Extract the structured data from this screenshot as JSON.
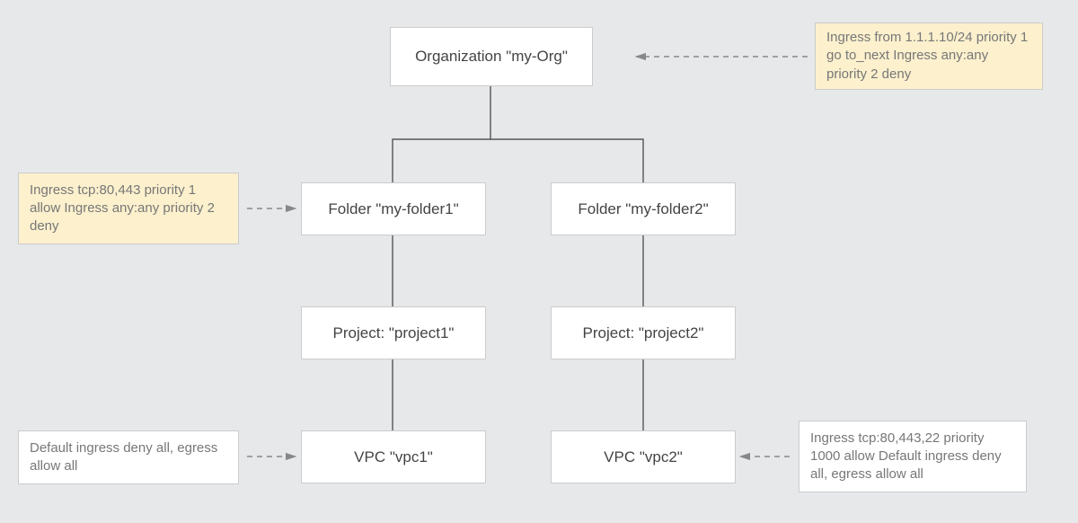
{
  "org": {
    "label": "Organization \"my-Org\""
  },
  "folder1": {
    "label": "Folder \"my-folder1\""
  },
  "folder2": {
    "label": "Folder \"my-folder2\""
  },
  "project1": {
    "label": "Project: \"project1\""
  },
  "project2": {
    "label": "Project: \"project2\""
  },
  "vpc1": {
    "label": "VPC \"vpc1\""
  },
  "vpc2": {
    "label": "VPC \"vpc2\""
  },
  "callout_org": {
    "text": "Ingress from 1.1.1.10/24 priority 1 go to_next Ingress any:any priority 2 deny"
  },
  "callout_folder1": {
    "text": "Ingress tcp:80,443 priority 1 allow Ingress any:any priority 2 deny"
  },
  "callout_vpc1": {
    "text": "Default ingress deny all, egress allow all"
  },
  "callout_vpc2": {
    "text": "Ingress tcp:80,443,22 priority 1000 allow Default ingress deny all, egress allow all"
  }
}
